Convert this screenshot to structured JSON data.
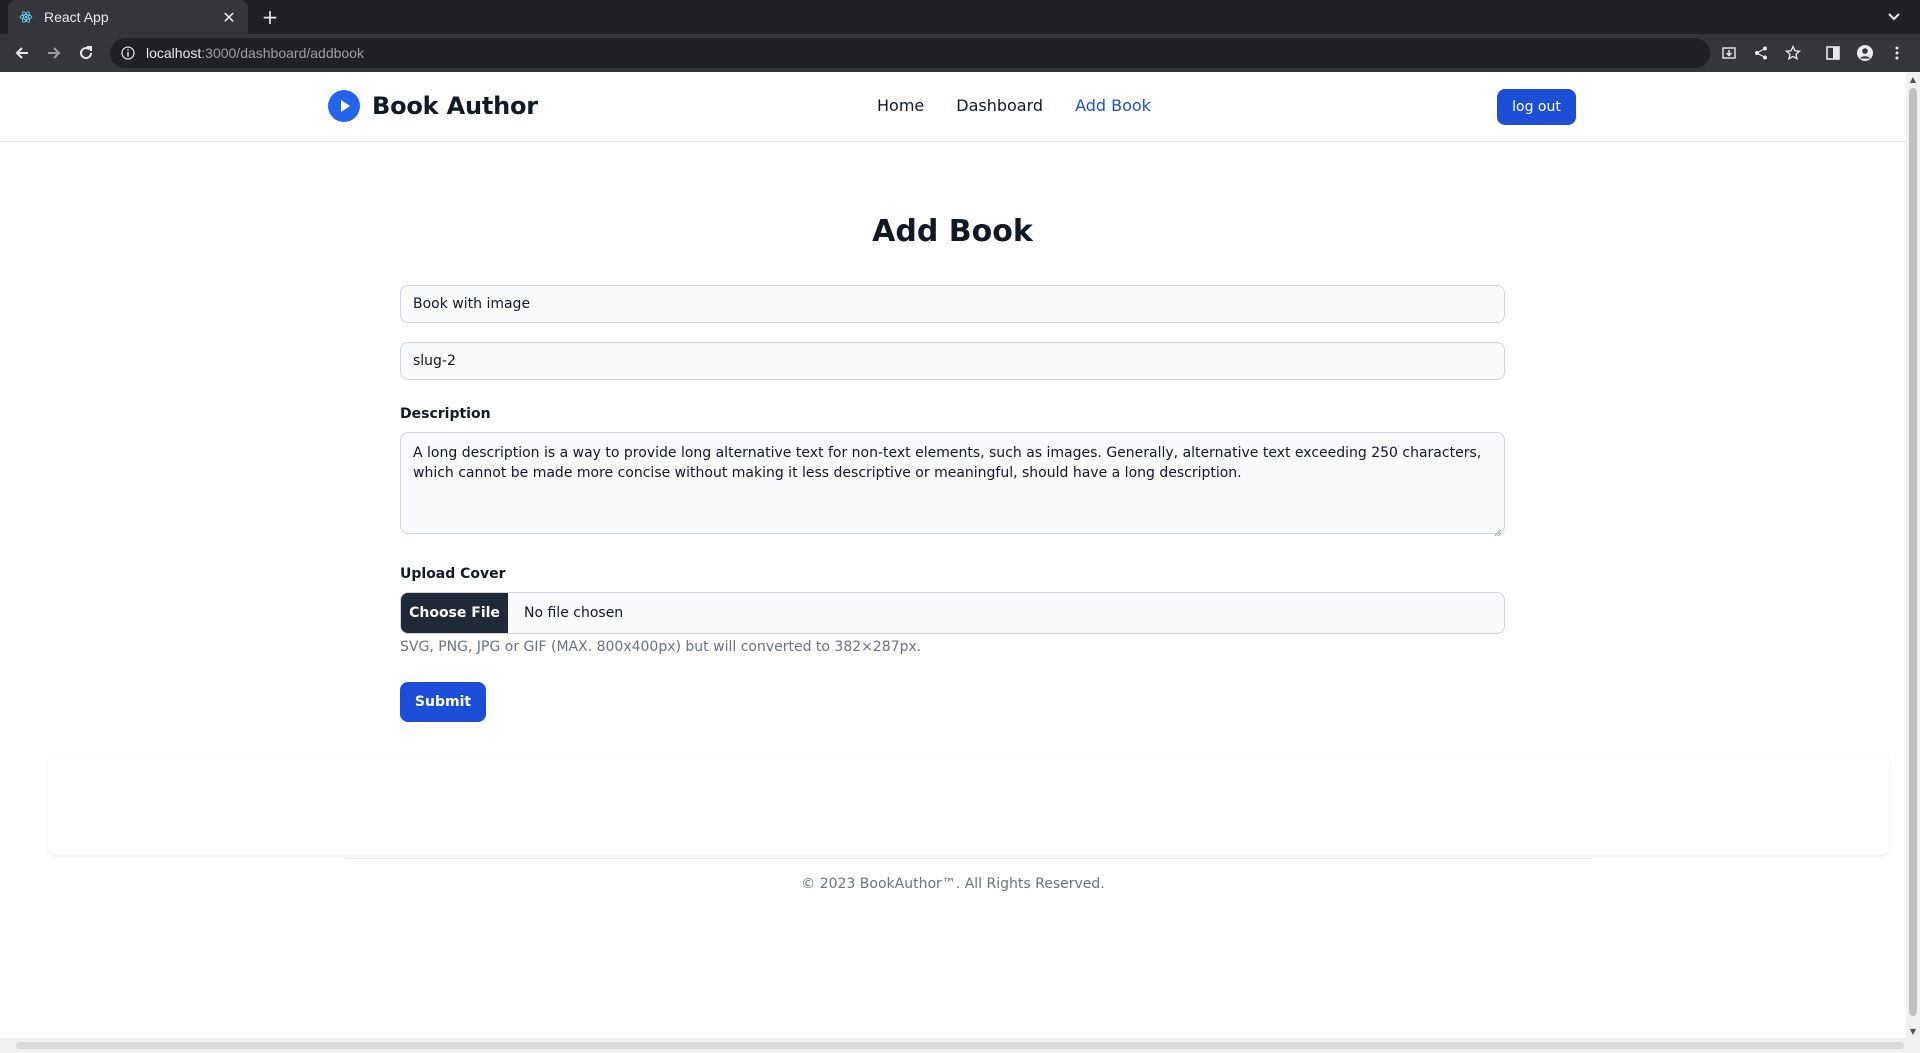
{
  "browser": {
    "tab_title": "React App",
    "url_host": "localhost",
    "url_path": ":3000/dashboard/addbook"
  },
  "navbar": {
    "brand": "Book Author",
    "links": [
      {
        "label": "Home",
        "active": false
      },
      {
        "label": "Dashboard",
        "active": false
      },
      {
        "label": "Add Book",
        "active": true
      }
    ],
    "logout_label": "log out"
  },
  "form": {
    "title": "Add Book",
    "book_title_value": "Book with image",
    "slug_value": "slug-2",
    "description_label": "Description",
    "description_value": "A long description is a way to provide long alternative text for non-text elements, such as images. Generally, alternative text exceeding 250 characters, which cannot be made more concise without making it less descriptive or meaningful, should have a long description.",
    "upload_label": "Upload Cover",
    "choose_file_label": "Choose File",
    "file_status": "No file chosen",
    "upload_help": "SVG, PNG, JPG or GIF (MAX. 800x400px) but will converted to 382×287px.",
    "submit_label": "Submit"
  },
  "footer": {
    "copyright": "© 2023 BookAuthor™. All Rights Reserved."
  },
  "colors": {
    "primary": "#1d4ed8",
    "dark_button": "#1f2937",
    "chrome_dark": "#202124",
    "chrome_toolbar": "#35363a"
  }
}
